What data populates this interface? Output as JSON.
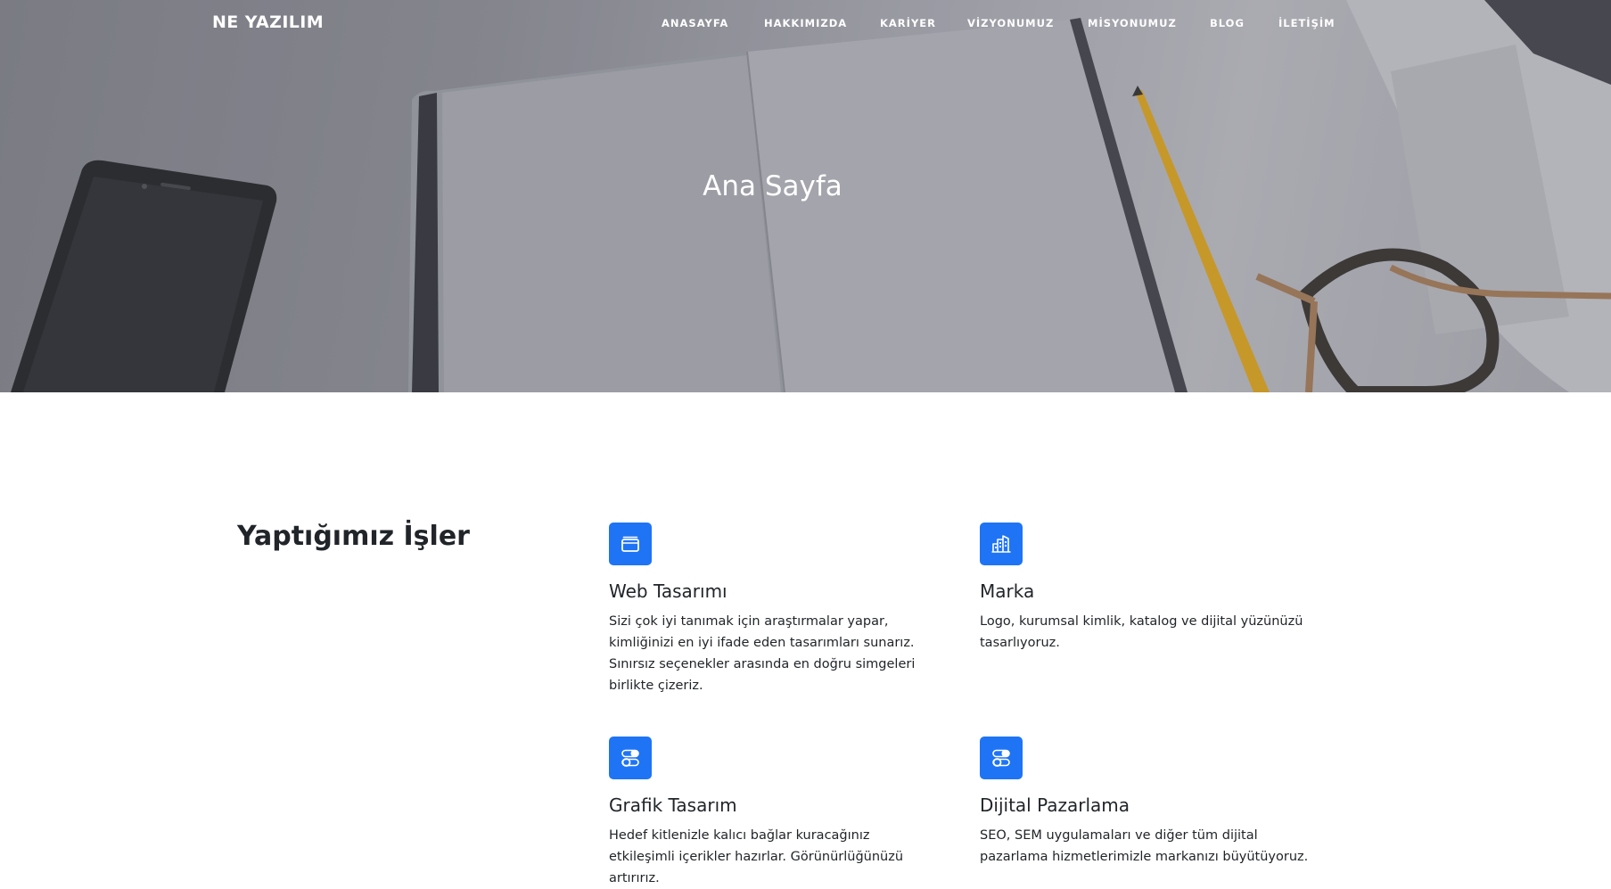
{
  "brand": "NE YAZILIM",
  "nav": [
    {
      "label": "ANASAYFA"
    },
    {
      "label": "HAKKIMIZDA"
    },
    {
      "label": "KARİYER"
    },
    {
      "label": "VİZYONUMUZ"
    },
    {
      "label": "MİSYONUMUZ"
    },
    {
      "label": "BLOG"
    },
    {
      "label": "İLETİŞİM"
    }
  ],
  "hero": {
    "title": "Ana Sayfa"
  },
  "services": {
    "title": "Yaptığımız İşler",
    "items": [
      {
        "icon": "window-icon",
        "title": "Web Tasarımı",
        "text": "Sizi çok iyi tanımak için araştırmalar yapar, kimliğinizi en iyi ifade eden tasarımları sunarız. Sınırsız seçenekler arasında en doğru simgeleri birlikte çizeriz."
      },
      {
        "icon": "building-icon",
        "title": "Marka",
        "text": "Logo, kurumsal kimlik, katalog ve dijital yüzünüzü tasarlıyoruz."
      },
      {
        "icon": "toggles-icon",
        "title": "Grafik Tasarım",
        "text": "Hedef kitlenizle kalıcı bağlar kuracağınız etkileşimli içerikler hazırlar. Görünürlüğünüzü artırırız."
      },
      {
        "icon": "toggles-icon",
        "title": "Dijital Pazarlama",
        "text": "SEO, SEM uygulamaları ve diğer tüm dijital pazarlama hizmetlerimizle markanızı büyütüyoruz."
      }
    ]
  },
  "colors": {
    "accent": "#1f74f5",
    "text": "#212529",
    "nav_text": "#ffffff"
  }
}
